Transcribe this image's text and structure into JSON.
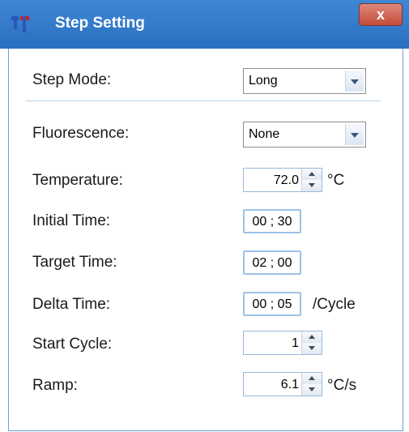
{
  "window": {
    "title": "Step Setting",
    "close_label": "x"
  },
  "step_mode": {
    "label": "Step Mode:",
    "value": "Long"
  },
  "fluorescence": {
    "label": "Fluorescence:",
    "value": "None"
  },
  "temperature": {
    "label": "Temperature:",
    "value": "72.0",
    "unit": "°C"
  },
  "initial_time": {
    "label": "Initial Time:",
    "value": "00 ; 30"
  },
  "target_time": {
    "label": "Target Time:",
    "value": "02 ; 00"
  },
  "delta_time": {
    "label": "Delta Time:",
    "value": "00 ; 05",
    "unit": "/Cycle"
  },
  "start_cycle": {
    "label": "Start Cycle:",
    "value": "1"
  },
  "ramp": {
    "label": "Ramp:",
    "value": "6.1",
    "unit": "°C/s"
  },
  "colors": {
    "titlebar": "#2f7ac8",
    "close": "#c44b39",
    "logo_blue": "#2a56b8",
    "logo_red": "#d42020"
  }
}
